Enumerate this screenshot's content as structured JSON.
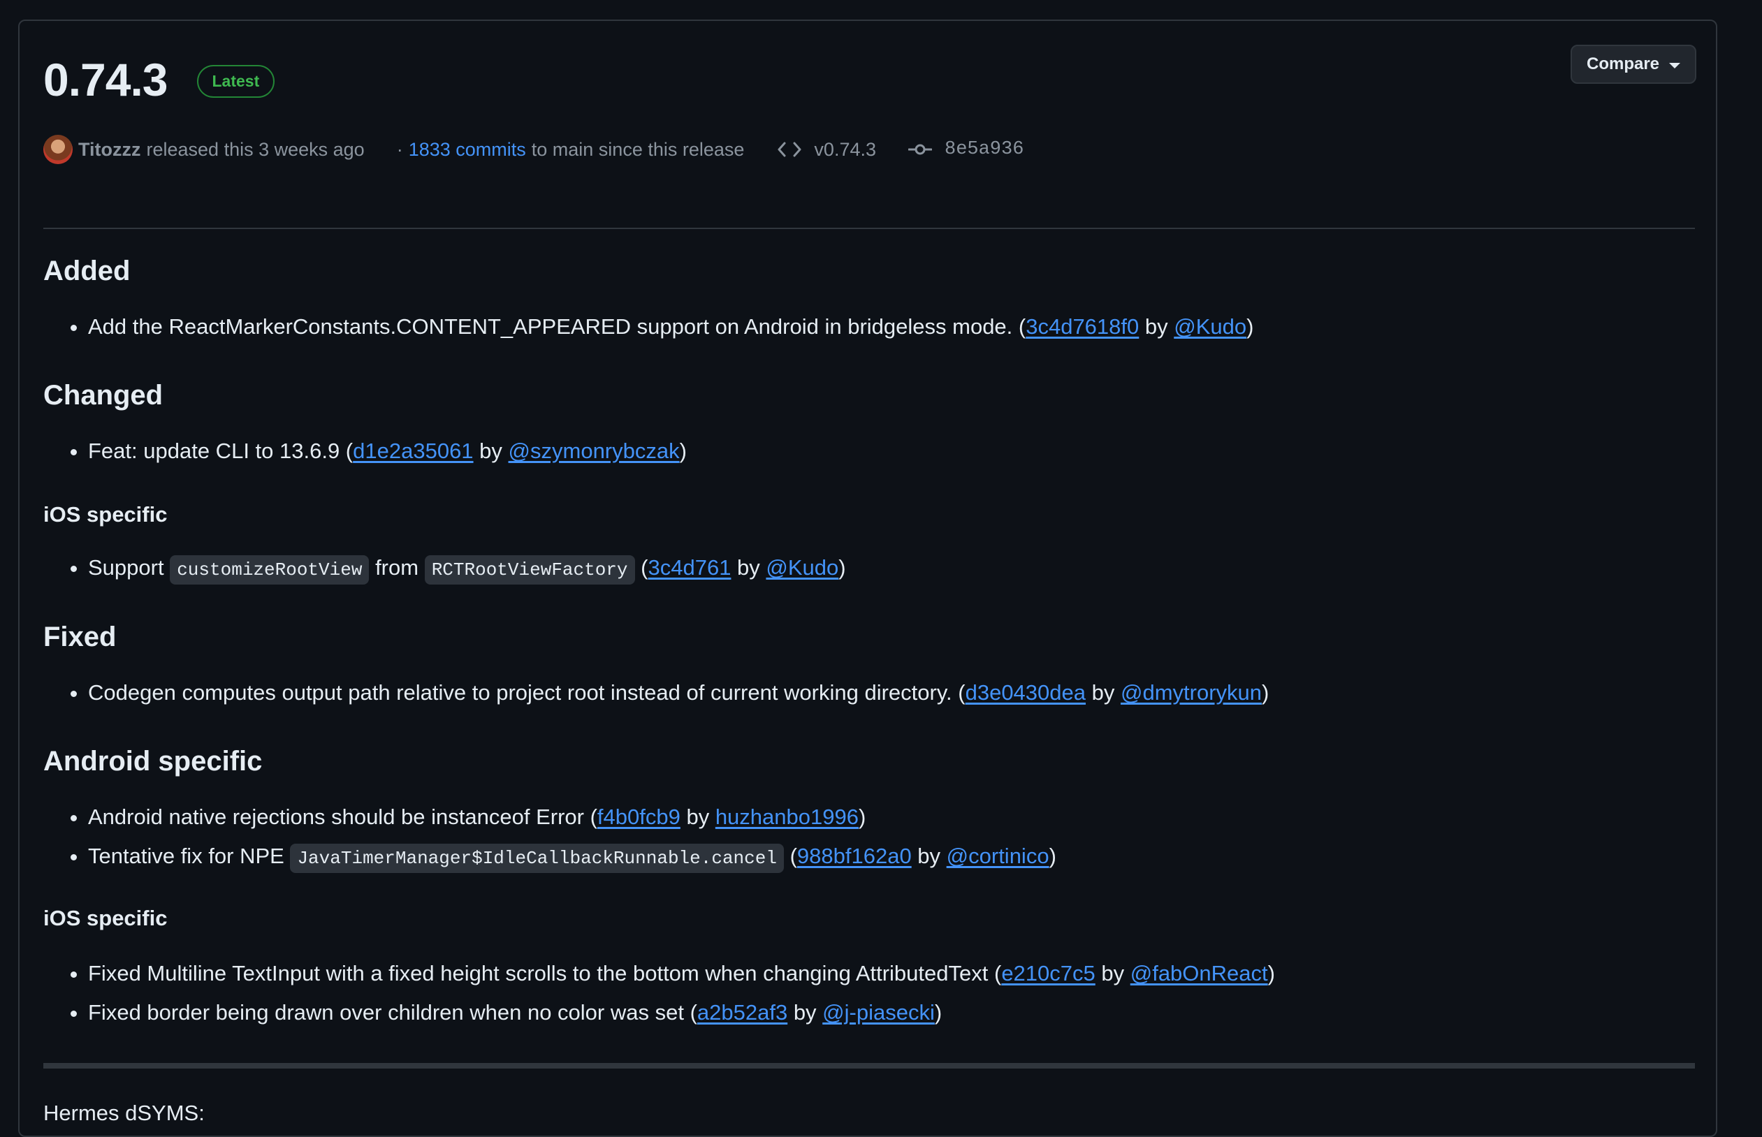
{
  "release": {
    "version": "0.74.3",
    "badge": "Latest",
    "compare_label": "Compare",
    "author": "Titozzz",
    "released_text": "released this 3 weeks ago",
    "dot": "·",
    "commits_count_text": "1833 commits",
    "commits_suffix": "to main since this release",
    "tag": "v0.74.3",
    "sha": "8e5a936"
  },
  "notes": {
    "added": {
      "heading": "Added",
      "items": [
        {
          "text": "Add the ReactMarkerConstants.CONTENT_APPEARED support on Android in bridgeless mode. (",
          "commit": "3c4d7618f0",
          "by": " by ",
          "user": "@Kudo",
          "close": ")"
        }
      ]
    },
    "changed": {
      "heading": "Changed",
      "items": [
        {
          "text": "Feat: update CLI to 13.6.9 (",
          "commit": "d1e2a35061",
          "by": " by ",
          "user": "@szymonrybczak",
          "close": ")"
        }
      ],
      "ios_heading": "iOS specific",
      "ios_item": {
        "pre": "Support ",
        "code1": "customizeRootView",
        "mid": " from ",
        "code2": "RCTRootViewFactory",
        "open": " (",
        "commit": "3c4d761",
        "by": " by ",
        "user": "@Kudo",
        "close": ")"
      }
    },
    "fixed": {
      "heading": "Fixed",
      "items": [
        {
          "text": "Codegen computes output path relative to project root instead of current working directory. (",
          "commit": "d3e0430dea",
          "by": " by ",
          "user": "@dmytrorykun",
          "close": ")"
        }
      ]
    },
    "android": {
      "heading": "Android specific",
      "item1": {
        "text": "Android native rejections should be instanceof Error (",
        "commit": "f4b0fcb9",
        "by": " by ",
        "user": "huzhanbo1996",
        "close": ")"
      },
      "item2": {
        "pre": "Tentative fix for NPE ",
        "code": "JavaTimerManager$IdleCallbackRunnable.cancel",
        "open": " (",
        "commit": "988bf162a0",
        "by": " by ",
        "user": "@cortinico",
        "close": ")"
      }
    },
    "ios2": {
      "heading": "iOS specific",
      "items": [
        {
          "text": "Fixed Multiline TextInput with a fixed height scrolls to the bottom when changing AttributedText (",
          "commit": "e210c7c5",
          "by": " by ",
          "user": "@fabOnReact",
          "close": ")"
        },
        {
          "text": "Fixed border being drawn over children when no color was set (",
          "commit": "a2b52af3",
          "by": " by ",
          "user": "@j-piasecki",
          "close": ")"
        }
      ]
    },
    "hermes_label": "Hermes dSYMS:"
  },
  "colors": {
    "background": "#0d1117",
    "border": "#30363d",
    "link": "#4493f8",
    "badge_green": "#3fb950",
    "text": "#e6edf3",
    "muted": "#8b949e"
  },
  "icons": [
    "code-icon",
    "git-commit-icon",
    "chevron-down-icon",
    "avatar"
  ]
}
